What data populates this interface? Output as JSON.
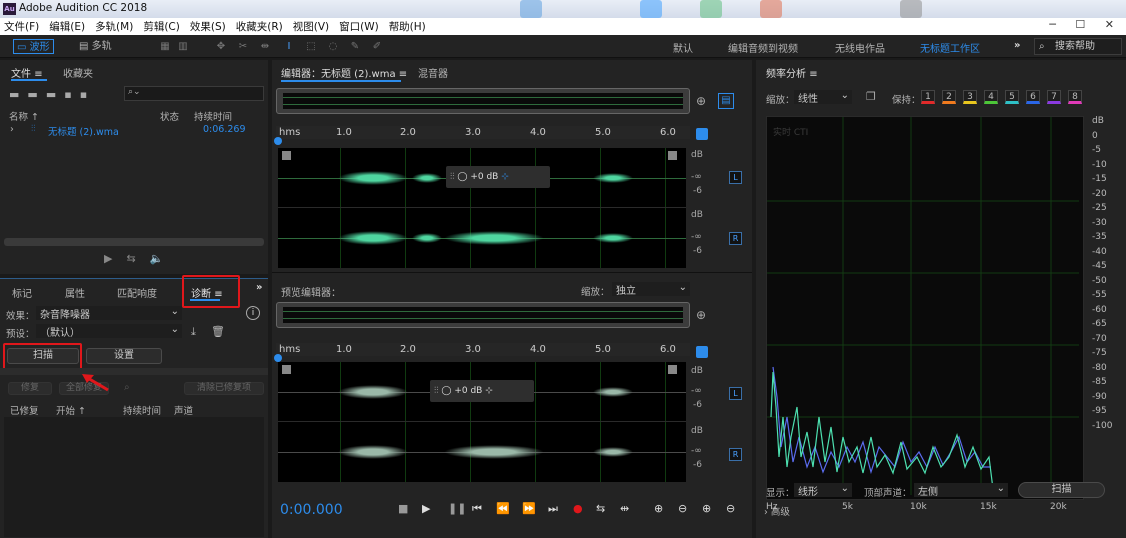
{
  "app": {
    "title": "Adobe Audition CC 2018",
    "logo": "Au"
  },
  "menu": [
    "文件(F)",
    "编辑(E)",
    "多轨(M)",
    "剪辑(C)",
    "效果(S)",
    "收藏夹(R)",
    "视图(V)",
    "窗口(W)",
    "帮助(H)"
  ],
  "toolbar": {
    "waveform": "波形",
    "multitrack": "多轨"
  },
  "workspaces": [
    "默认",
    "编辑音频到视频",
    "无线电作品",
    "无标题工作区"
  ],
  "search_help": "搜索帮助",
  "files_panel": {
    "tab_files": "文件",
    "tab_favorites": "收藏夹",
    "col_name": "名称 ↑",
    "col_status": "状态",
    "col_duration": "持续时间",
    "file_name": "无标题 (2).wma",
    "file_duration": "0:06.269"
  },
  "diag_panel": {
    "tabs": [
      "标记",
      "属性",
      "匹配响度",
      "诊断"
    ],
    "effect_label": "效果：",
    "effect_value": "杂音降噪器",
    "preset_label": "预设：",
    "preset_value": "（默认）",
    "scan": "扫描",
    "settings": "设置",
    "repair": "修复",
    "repair_all": "全部修复",
    "clear_repaired": "清除已修复项",
    "cols": [
      "已修复",
      "开始 ↑",
      "持续时间",
      "声道"
    ]
  },
  "editor": {
    "tab": "编辑器：无标题 (2).wma",
    "mixer": "混音器",
    "preview_tab": "预览编辑器：",
    "zoom_label": "缩放：",
    "zoom_value": "独立",
    "ruler": [
      "hms",
      "1.0",
      "2.0",
      "3.0",
      "4.0",
      "5.0",
      "6.0"
    ],
    "db_label": "dB",
    "db_ticks": [
      "-∞",
      "-6"
    ],
    "hud_db": "+0 dB",
    "L": "L",
    "R": "R",
    "time": "0:00.000"
  },
  "freq": {
    "title": "频率分析",
    "zoom_label": "缩放：",
    "zoom_value": "线性",
    "hold_label": "保持：",
    "hold_slots": [
      "1",
      "2",
      "3",
      "4",
      "5",
      "6",
      "7",
      "8"
    ],
    "hold_colors": [
      "#e02a2a",
      "#f07a1e",
      "#e8c61e",
      "#4cc638",
      "#2ec0c6",
      "#2a66e8",
      "#8a3ae0",
      "#e03ab8"
    ],
    "realtime": "实时 CTI",
    "y_ticks": [
      "dB",
      "0",
      "-5",
      "-10",
      "-15",
      "-20",
      "-25",
      "-30",
      "-35",
      "-40",
      "-45",
      "-50",
      "-55",
      "-60",
      "-65",
      "-70",
      "-75",
      "-80",
      "-85",
      "-90",
      "-95",
      "-100"
    ],
    "x_ticks": [
      "Hz",
      "5k",
      "10k",
      "15k",
      "20k"
    ],
    "display_label": "显示：",
    "display_value": "线形",
    "top_channel_label": "顶部声道：",
    "top_channel_value": "左侧",
    "scan": "扫描",
    "advanced": "高级"
  }
}
